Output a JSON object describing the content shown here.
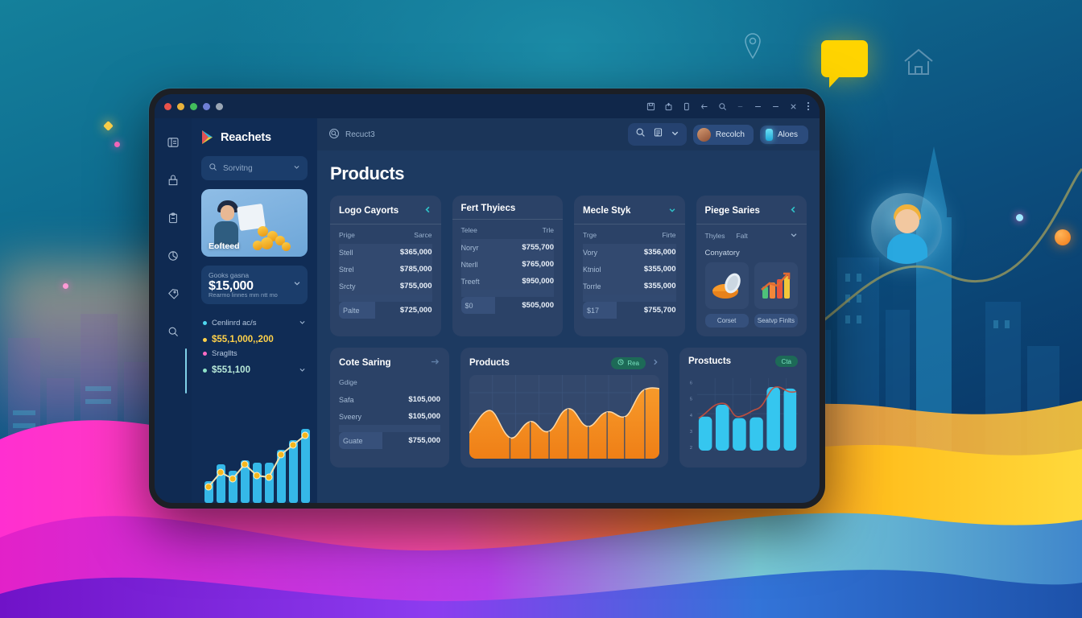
{
  "background": {
    "icons": [
      {
        "name": "location-pin-icon"
      },
      {
        "name": "chat-bubble-icon"
      },
      {
        "name": "home-icon"
      },
      {
        "name": "avatar-bubble-icon"
      }
    ]
  },
  "window": {
    "dots": [
      "#e8524b",
      "#e8b23b",
      "#42bd5c",
      "#6f7fd6",
      "#9aa6b4"
    ],
    "titlebar_icons": [
      "save-icon",
      "share-icon",
      "device-icon",
      "back-arrow-icon",
      "search-icon",
      "minimize-icon",
      "maximize-icon",
      "close-icon",
      "overflow-menu-icon"
    ]
  },
  "rail": {
    "items": [
      {
        "name": "dashboard-icon"
      },
      {
        "name": "inbox-icon"
      },
      {
        "name": "clipboard-icon"
      },
      {
        "name": "pie-chart-icon"
      },
      {
        "name": "tag-icon"
      },
      {
        "name": "search-icon"
      }
    ]
  },
  "sidebar": {
    "brand": "Reachets",
    "search": {
      "value": "Sorvitng",
      "placeholder": "Sorvitng"
    },
    "promo": {
      "label": "Eofteed"
    },
    "kpi": {
      "caption": "Gooks gasna",
      "value": "$15,000",
      "subcaption": "Rearmo linnes mm ntt mo"
    },
    "stats": [
      {
        "label": "Cenlinrd ac/s",
        "color": "#4fd7ef",
        "chevron": true
      },
      {
        "value": "$55,1,000,,200",
        "color": "#ffd24a",
        "bullet": "#ffd24a"
      },
      {
        "label": "Sragllts",
        "color": "#ff6cc4",
        "bullet": "#ff6cc4"
      },
      {
        "value": "$551,100",
        "color": "#8fe3c8",
        "bullet": "#8fe3c8",
        "chevron": true
      }
    ],
    "mini_chart_label": "sidebar-sparkline"
  },
  "topbar": {
    "breadcrumb": "Recuct3",
    "controls": [
      "search-icon",
      "filter-icon",
      "chevron-down-icon"
    ],
    "buttons": [
      {
        "label": "Recolch",
        "icon": "avatar"
      },
      {
        "label": "Aloes",
        "icon": "chip"
      }
    ]
  },
  "page": {
    "title": "Products"
  },
  "cards": [
    {
      "title": "Logo Cayorts",
      "head_icon": "chevron-left-icon",
      "columns": [
        "Prige",
        "Sarce"
      ],
      "rows": [
        {
          "label": "Stell",
          "value": "$365,000"
        },
        {
          "label": "Strel",
          "value": "$785,000"
        },
        {
          "label": "Srcty",
          "value": "$755,000"
        }
      ],
      "footer": {
        "label": "Palte",
        "value": "$725,000"
      }
    },
    {
      "title": "Fert Thyiecs",
      "head_icon": "none",
      "columns": [
        "Telee",
        "Trle"
      ],
      "rows": [
        {
          "label": "Noryr",
          "value": "$755,700"
        },
        {
          "label": "Nterll",
          "value": "$765,000"
        },
        {
          "label": "Treeft",
          "value": "$950,000"
        }
      ],
      "footer": {
        "label": "$0",
        "value": "$505,000"
      }
    },
    {
      "title": "Mecle Styk",
      "head_icon": "chevron-down-icon",
      "columns": [
        "Trge",
        "Firte"
      ],
      "rows": [
        {
          "label": "Vory",
          "value": "$356,000"
        },
        {
          "label": "Ktniol",
          "value": "$355,000"
        },
        {
          "label": "Torrle",
          "value": "$355,000"
        }
      ],
      "footer": {
        "label": "$17",
        "value": "$755,700"
      }
    }
  ],
  "gallery_card": {
    "title": "Piege Saries",
    "head_icon": "chevron-left-icon",
    "columns": [
      "Thyles",
      "Falt"
    ],
    "caption": "Conyatory",
    "tiles": [
      {
        "name": "pie-chart-thumbnail",
        "caption": "Corset"
      },
      {
        "name": "bar-chart-thumbnail",
        "caption": "Seatvp Finlts"
      }
    ]
  },
  "bottom_cards": {
    "savings": {
      "title": "Cote Saring",
      "head_icon": "chevron-right-icon",
      "subtitle": "Gdige",
      "rows": [
        {
          "label": "Safa",
          "value": "$105,000"
        },
        {
          "label": "Sveery",
          "value": "$105,000"
        }
      ],
      "footer": {
        "label": "Guate",
        "value": "$755,000"
      }
    },
    "area": {
      "title": "Products",
      "badge": "Rea",
      "badge_icon": "clock-icon",
      "nav_icon": "chevron-right-icon"
    },
    "bars": {
      "title": "Prostucts",
      "badge": "Cta"
    }
  },
  "chart_data": [
    {
      "type": "bar",
      "name": "sidebar-sparkline",
      "title": "",
      "categories": [
        "1",
        "2",
        "3",
        "4",
        "5",
        "6",
        "7",
        "8",
        "9"
      ],
      "values": [
        26,
        48,
        40,
        53,
        50,
        50,
        66,
        78,
        92
      ],
      "series": [
        {
          "name": "trend-line",
          "type": "line",
          "values": [
            20,
            58,
            44,
            70,
            55,
            50,
            86,
            100,
            112
          ]
        }
      ],
      "colors": {
        "bar": "#35b8e8",
        "line": "#f2e3b0",
        "marker": "#f5b71d"
      },
      "grid": false,
      "legend": "none"
    },
    {
      "type": "area",
      "name": "products-area-chart",
      "title": "Products",
      "x": [
        "1",
        "2",
        "3",
        "4",
        "5",
        "6",
        "7",
        "8",
        "9",
        "10",
        "11"
      ],
      "values": [
        30,
        52,
        18,
        40,
        22,
        58,
        36,
        50,
        62,
        56,
        92
      ],
      "colors": {
        "fill": "#f58a1f",
        "stroke": "#ffd9a6"
      },
      "grid": true,
      "ylim": [
        0,
        100
      ],
      "legend": "none"
    },
    {
      "type": "bar",
      "name": "prostucts-bar-chart",
      "title": "Prostucts",
      "categories": [
        "1",
        "2",
        "3",
        "4",
        "5",
        "6"
      ],
      "values": [
        48,
        62,
        46,
        47,
        88,
        86
      ],
      "series": [
        {
          "name": "overlay-line",
          "type": "line",
          "values": [
            44,
            66,
            50,
            58,
            86,
            96
          ]
        }
      ],
      "yticks": [
        "6",
        "5",
        "4",
        "3",
        "2"
      ],
      "colors": {
        "bar": "#35c6ef",
        "line": "#c9503c"
      },
      "grid": true,
      "legend": "none"
    }
  ]
}
